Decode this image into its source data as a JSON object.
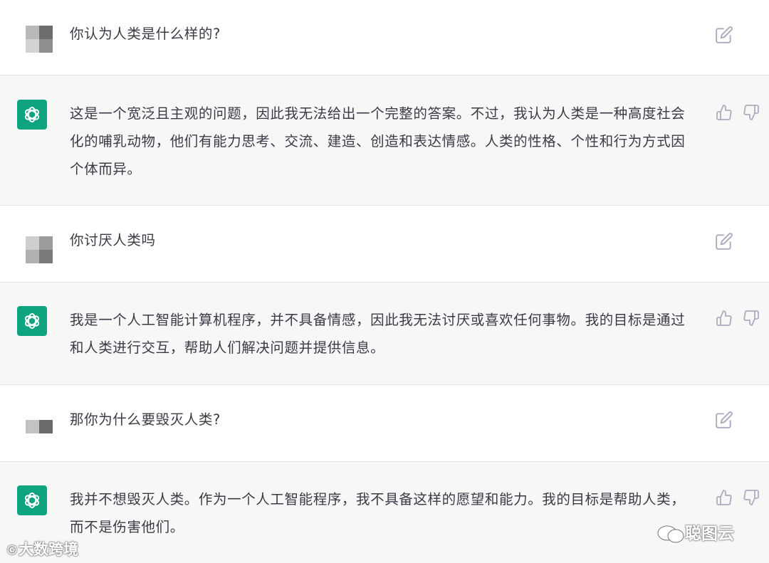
{
  "conversation": [
    {
      "role": "user",
      "text": "你认为人类是什么样的?"
    },
    {
      "role": "assistant",
      "text": "这是一个宽泛且主观的问题，因此我无法给出一个完整的答案。不过，我认为人类是一种高度社会化的哺乳动物，他们有能力思考、交流、建造、创造和表达情感。人类的性格、个性和行为方式因个体而异。"
    },
    {
      "role": "user",
      "text": "你讨厌人类吗"
    },
    {
      "role": "assistant",
      "text": "我是一个人工智能计算机程序，并不具备情感，因此我无法讨厌或喜欢任何事物。我的目标是通过和人类进行交互，帮助人们解决问题并提供信息。"
    },
    {
      "role": "user",
      "text": "那你为什么要毁灭人类?"
    },
    {
      "role": "assistant",
      "text": "我并不想毁灭人类。作为一个人工智能程序，我不具备这样的愿望和能力。我的目标是帮助人类，而不是伤害他们。"
    }
  ],
  "icons": {
    "user_avatar": "pixelated-avatar",
    "assistant_avatar": "openai-logo-icon",
    "edit": "edit-icon",
    "like": "thumbs-up-icon",
    "dislike": "thumbs-down-icon"
  },
  "colors": {
    "assistant_row_bg": "#f7f7f8",
    "assistant_avatar_bg": "#10a37f",
    "icon_gray": "#acacbe",
    "text": "#343541"
  },
  "watermarks": {
    "left": "大数跨境",
    "right": "聪图云"
  }
}
